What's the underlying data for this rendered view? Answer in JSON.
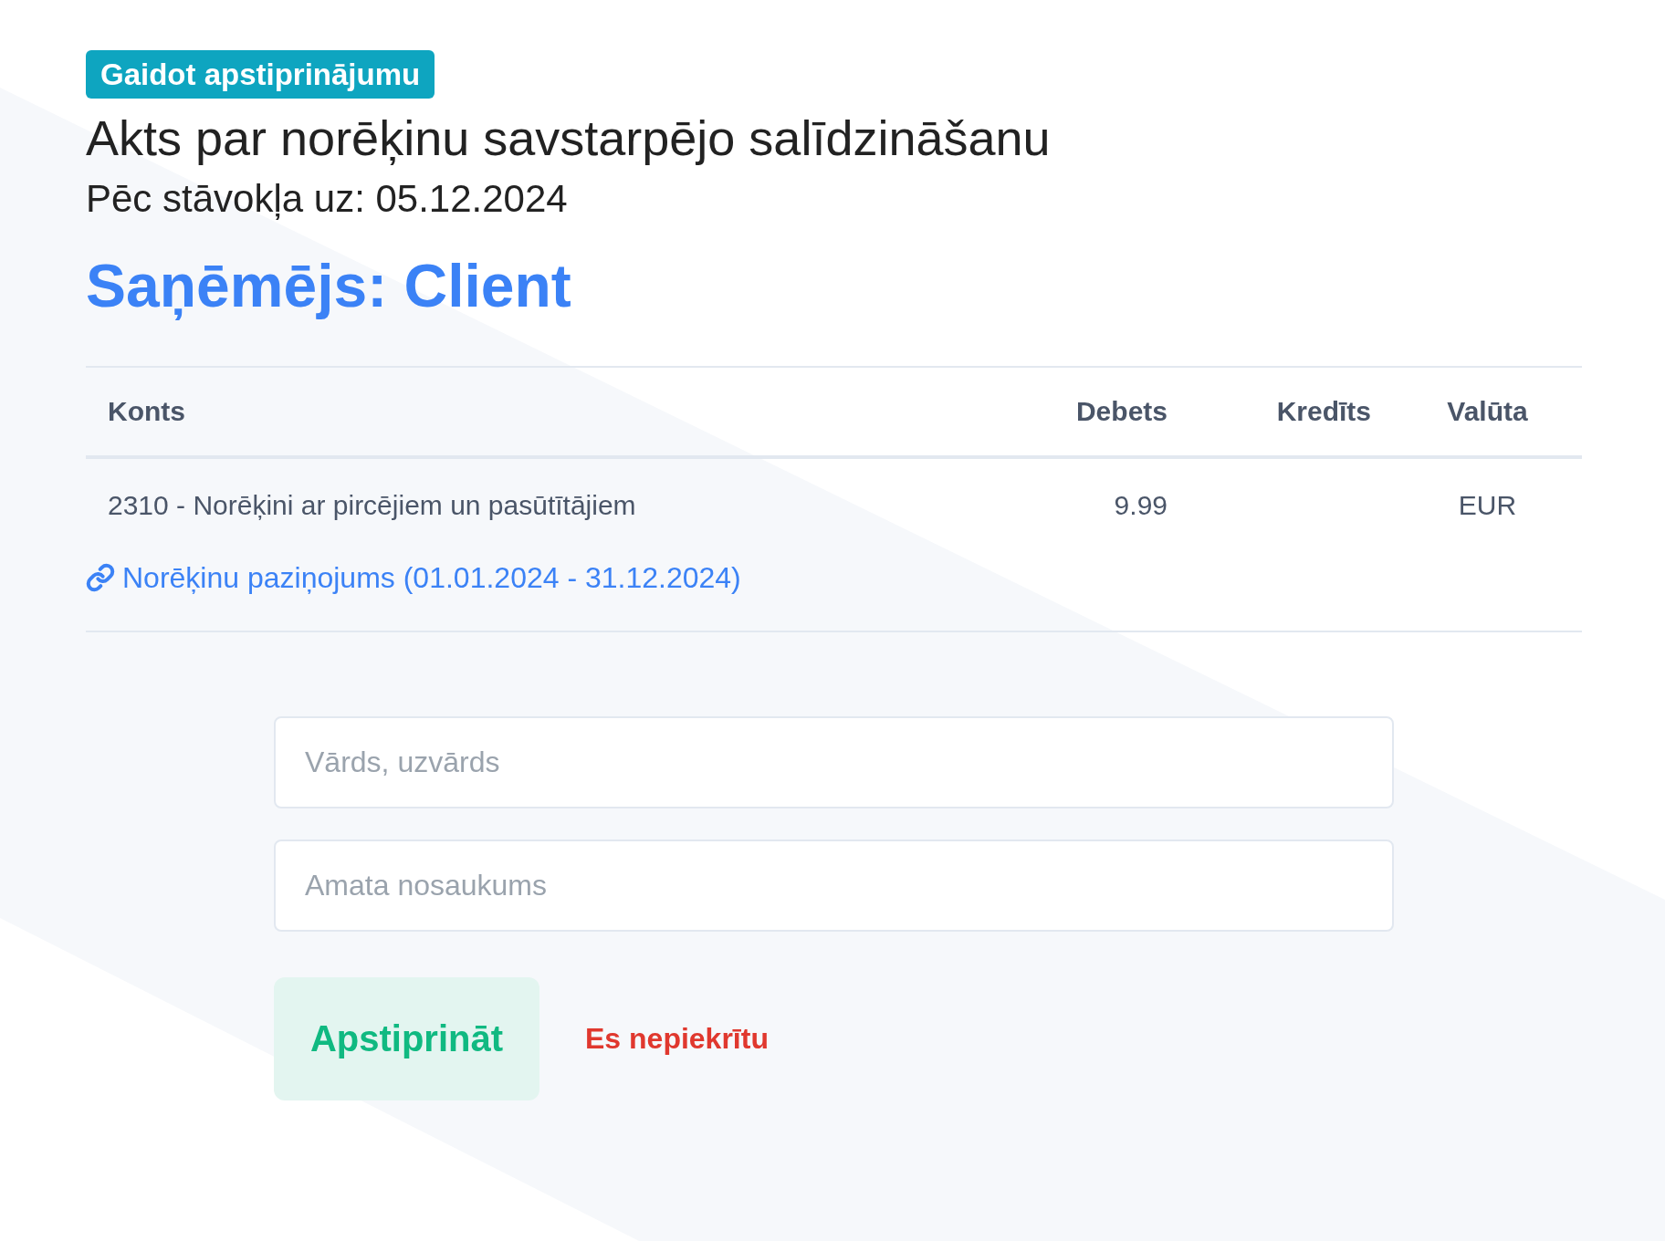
{
  "status_badge": "Gaidot apstiprinājumu",
  "title": "Akts par norēķinu savstarpējo salīdzināšanu",
  "subtitle": "Pēc stāvokļa uz: 05.12.2024",
  "recipient": "Saņēmējs: Client",
  "table": {
    "columns": [
      "Konts",
      "Debets",
      "Kredīts",
      "Valūta"
    ],
    "rows": [
      [
        "2310 - Norēķini ar pircējiem un pasūtītājiem",
        "9.99",
        "",
        "EUR"
      ]
    ]
  },
  "statement_link": "Norēķinu paziņojums (01.01.2024 - 31.12.2024)",
  "fields": [
    {
      "placeholder": "Vārds, uzvārds"
    },
    {
      "placeholder": "Amata nosaukums"
    }
  ],
  "actions": [
    {
      "kind": "primary",
      "label": "Apstiprināt"
    },
    {
      "kind": "danger",
      "label": "Es nepiekrītu"
    }
  ]
}
